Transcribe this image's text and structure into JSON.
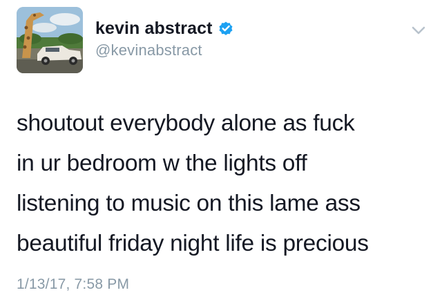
{
  "tweet": {
    "author": {
      "display_name": "kevin abstract",
      "handle": "@kevinabstract",
      "verified": true,
      "avatar_icon": "profile-photo-giraffe-car"
    },
    "menu_icon": "chevron-down-icon",
    "text": "shoutout everybody alone as fuck\nin ur bedroom w the lights off\nlistening to music on this lame ass\nbeautiful friday night life is precious",
    "timestamp": "1/13/17, 7:58 PM"
  },
  "colors": {
    "verified_badge": "#1da1f2",
    "secondary_text": "#8899a6",
    "primary_text": "#141823"
  }
}
